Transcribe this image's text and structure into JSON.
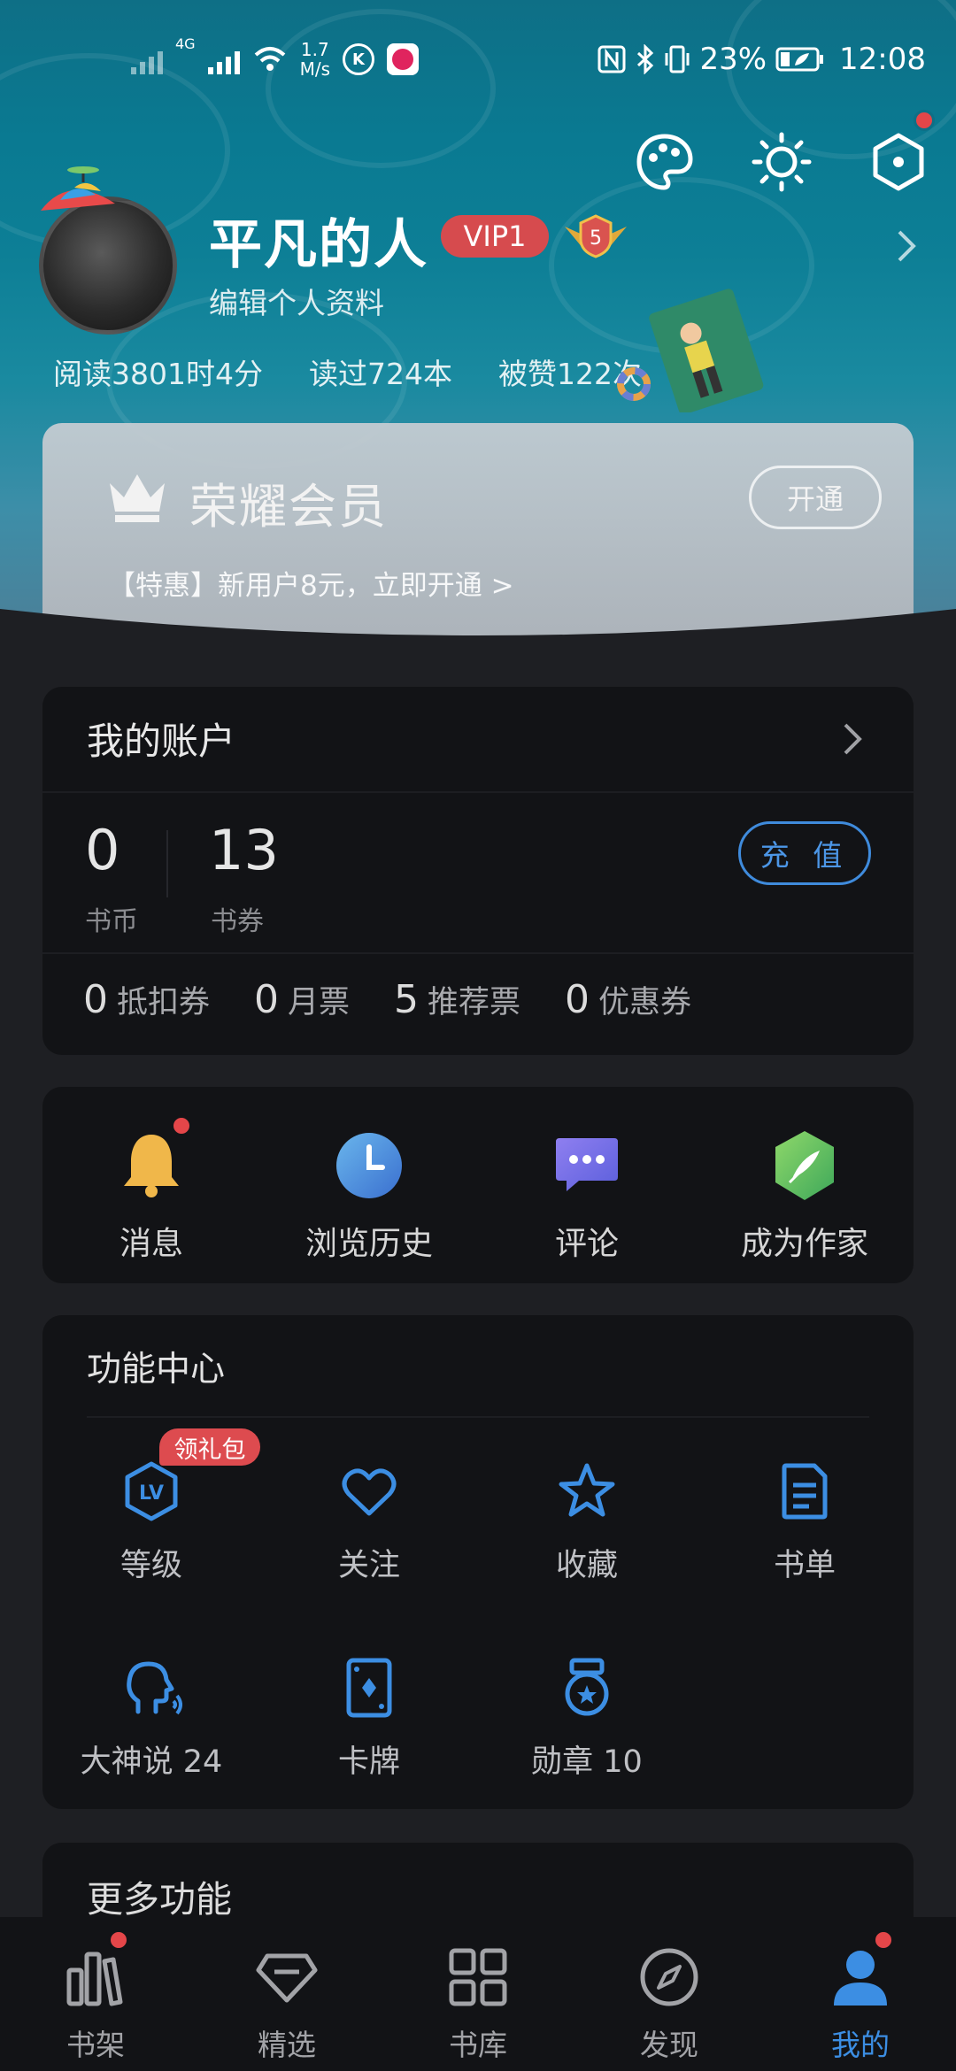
{
  "status_bar": {
    "speed_value": "1.7",
    "speed_unit": "M/s",
    "net_type": "4G",
    "battery": "23%",
    "time": "12:08"
  },
  "profile": {
    "username": "平凡的人",
    "vip_badge": "VIP1",
    "level": "5",
    "edit_link": "编辑个人资料",
    "stats": [
      "阅读3801时4分",
      "读过724本",
      "被赞122次"
    ]
  },
  "vip_card": {
    "title": "荣耀会员",
    "open_button": "开通",
    "promo": "【特惠】新用户8元，立即开通 >"
  },
  "account": {
    "title": "我的账户",
    "book_coin_value": "0",
    "book_coin_label": "书币",
    "book_voucher_value": "13",
    "book_voucher_label": "书券",
    "recharge_button": "充 值",
    "tickets": [
      {
        "value": "0",
        "label": "抵扣券"
      },
      {
        "value": "0",
        "label": "月票"
      },
      {
        "value": "5",
        "label": "推荐票"
      },
      {
        "value": "0",
        "label": "优惠券"
      }
    ]
  },
  "quick_actions": [
    {
      "label": "消息",
      "icon": "bell-icon"
    },
    {
      "label": "浏览历史",
      "icon": "clock-icon"
    },
    {
      "label": "评论",
      "icon": "chat-bubble-icon"
    },
    {
      "label": "成为作家",
      "icon": "quill-icon"
    }
  ],
  "function_center": {
    "title": "功能中心",
    "gift_badge": "领礼包",
    "items": [
      {
        "label": "等级",
        "icon": "level-icon"
      },
      {
        "label": "关注",
        "icon": "heart-icon"
      },
      {
        "label": "收藏",
        "icon": "star-icon"
      },
      {
        "label": "书单",
        "icon": "book-list-icon"
      },
      {
        "label": "大神说 24",
        "icon": "speaking-head-icon"
      },
      {
        "label": "卡牌",
        "icon": "card-icon"
      },
      {
        "label": "勋章 10",
        "icon": "medal-icon"
      }
    ]
  },
  "more": {
    "title": "更多功能"
  },
  "tabs": [
    {
      "label": "书架",
      "icon": "bookshelf-icon"
    },
    {
      "label": "精选",
      "icon": "diamond-icon"
    },
    {
      "label": "书库",
      "icon": "grid-icon"
    },
    {
      "label": "发现",
      "icon": "compass-icon"
    },
    {
      "label": "我的",
      "icon": "user-icon"
    }
  ],
  "colors": {
    "accent": "#3c8ee3",
    "vip_red": "#d64b4e",
    "badge_red": "#e44649",
    "card_bg": "#121316",
    "page_bg": "#1e1f23"
  }
}
